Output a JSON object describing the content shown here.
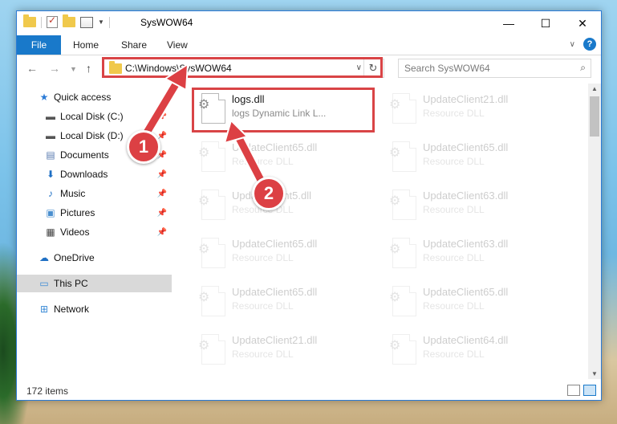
{
  "window": {
    "title": "SysWOW64",
    "controls": {
      "minimize": "—",
      "maximize": "☐",
      "close": "✕"
    }
  },
  "ribbon": {
    "tabs": [
      "File",
      "Home",
      "Share",
      "View"
    ]
  },
  "address": {
    "path": "C:\\Windows\\SysWOW64",
    "search_placeholder": "Search SysWOW64"
  },
  "navpane": {
    "items": [
      {
        "label": "Quick access",
        "icon": "star-icon",
        "pinned": false
      },
      {
        "label": "Local Disk (C:)",
        "icon": "drive-icon",
        "pinned": true
      },
      {
        "label": "Local Disk (D:)",
        "icon": "drive-icon",
        "pinned": true
      },
      {
        "label": "Documents",
        "icon": "documents-icon",
        "pinned": true
      },
      {
        "label": "Downloads",
        "icon": "download-icon",
        "pinned": true
      },
      {
        "label": "Music",
        "icon": "music-icon",
        "pinned": true
      },
      {
        "label": "Pictures",
        "icon": "pictures-icon",
        "pinned": true
      },
      {
        "label": "Videos",
        "icon": "videos-icon",
        "pinned": true
      },
      {
        "label": "OneDrive",
        "icon": "onedrive-icon",
        "pinned": false
      },
      {
        "label": "This PC",
        "icon": "pc-icon",
        "pinned": false,
        "selected": true
      },
      {
        "label": "Network",
        "icon": "network-icon",
        "pinned": false
      }
    ]
  },
  "files": {
    "highlighted": {
      "name": "logs.dll",
      "desc": "logs Dynamic Link L..."
    },
    "faded_left": [
      {
        "name": "UpdateClient65.dll",
        "desc": "Resource DLL"
      },
      {
        "name": "UpdateClient5.dll",
        "desc": "Resource DLL"
      },
      {
        "name": "UpdateClient65.dll",
        "desc": "Resource DLL"
      },
      {
        "name": "UpdateClient65.dll",
        "desc": "Resource DLL"
      },
      {
        "name": "UpdateClient21.dll",
        "desc": "Resource DLL"
      }
    ],
    "faded_right": [
      {
        "name": "UpdateClient21.dll",
        "desc": "Resource DLL"
      },
      {
        "name": "UpdateClient65.dll",
        "desc": "Resource DLL"
      },
      {
        "name": "UpdateClient63.dll",
        "desc": "Resource DLL"
      },
      {
        "name": "UpdateClient63.dll",
        "desc": "Resource DLL"
      },
      {
        "name": "UpdateClient65.dll",
        "desc": "Resource DLL"
      },
      {
        "name": "UpdateClient64.dll",
        "desc": "Resource DLL"
      }
    ]
  },
  "status": {
    "item_count": "172 items"
  },
  "annotations": {
    "badge1": "1",
    "badge2": "2",
    "color": "#dc4044"
  }
}
